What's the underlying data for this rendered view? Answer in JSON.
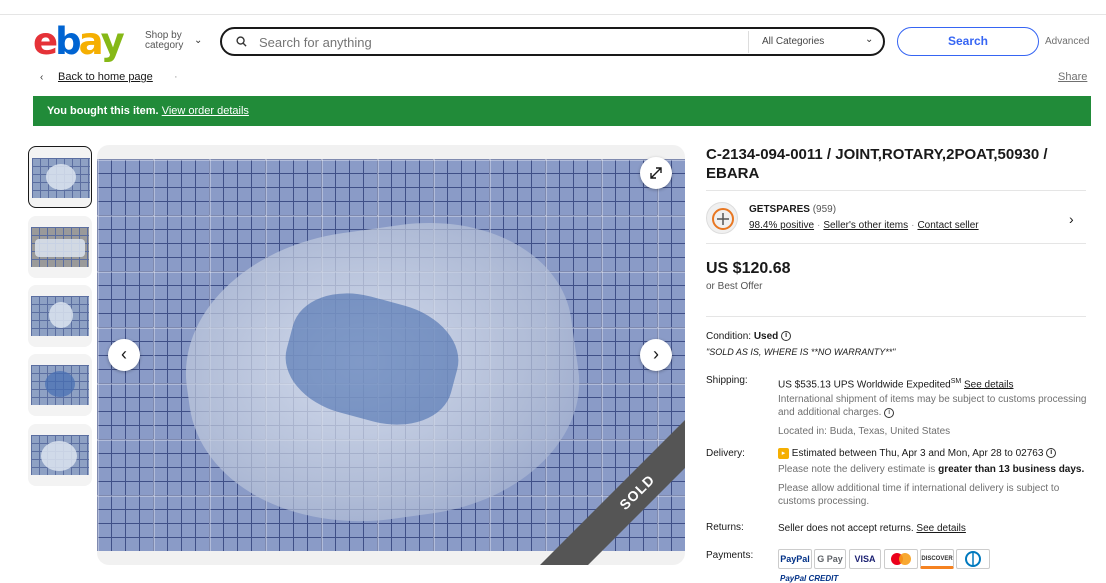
{
  "header": {
    "logo_letters": [
      {
        "ch": "e",
        "color": "#e53238"
      },
      {
        "ch": "b",
        "color": "#0064d2"
      },
      {
        "ch": "a",
        "color": "#f5af02"
      },
      {
        "ch": "y",
        "color": "#86b817"
      }
    ],
    "shop_by_line1": "Shop by",
    "shop_by_line2": "category",
    "search_placeholder": "Search for anything",
    "category_select": "All Categories",
    "search_button": "Search",
    "advanced": "Advanced"
  },
  "breadcrumb": {
    "back_label": "Back to home page",
    "share_label": "Share"
  },
  "banner": {
    "text": "You bought this item.",
    "link": "View order details",
    "color": "#218b39"
  },
  "gallery": {
    "thumbnail_count": 5,
    "sold_ribbon": "SOLD"
  },
  "item": {
    "title": "C-2134-094-0011 / JOINT,ROTARY,2POAT,50930 / EBARA",
    "seller": {
      "name": "GETSPARES",
      "feedback_count": "(959)",
      "positive": "98.4% positive",
      "other_items": "Seller's other items",
      "contact": "Contact seller"
    },
    "price": "US $120.68",
    "best_offer": "or Best Offer",
    "condition_label": "Condition:",
    "condition_value": "Used",
    "condition_note": "\"SOLD AS IS, WHERE IS **NO WARRANTY**\"",
    "shipping_label": "Shipping:",
    "shipping_value": "US $535.13 UPS Worldwide Expedited",
    "shipping_sup": "SM",
    "shipping_link": "See details",
    "shipping_note": "International shipment of items may be subject to customs processing and additional charges.",
    "location": "Located in: Buda, Texas, United States",
    "delivery_label": "Delivery:",
    "delivery_value": "Estimated between Thu, Apr 3 and Mon, Apr 28 to 02763",
    "delivery_note_pre": "Please note the delivery estimate is",
    "delivery_note_bold": "greater than 13 business days.",
    "delivery_note2": "Please allow additional time if international delivery is subject to customs processing.",
    "returns_label": "Returns:",
    "returns_value": "Seller does not accept returns.",
    "returns_link": "See details",
    "payments_label": "Payments:",
    "payment_methods": [
      "PayPal",
      "G Pay",
      "VISA",
      "Mastercard",
      "DISCOVER",
      "Diners Club"
    ],
    "paypal_credit": "PayPal CREDIT"
  }
}
